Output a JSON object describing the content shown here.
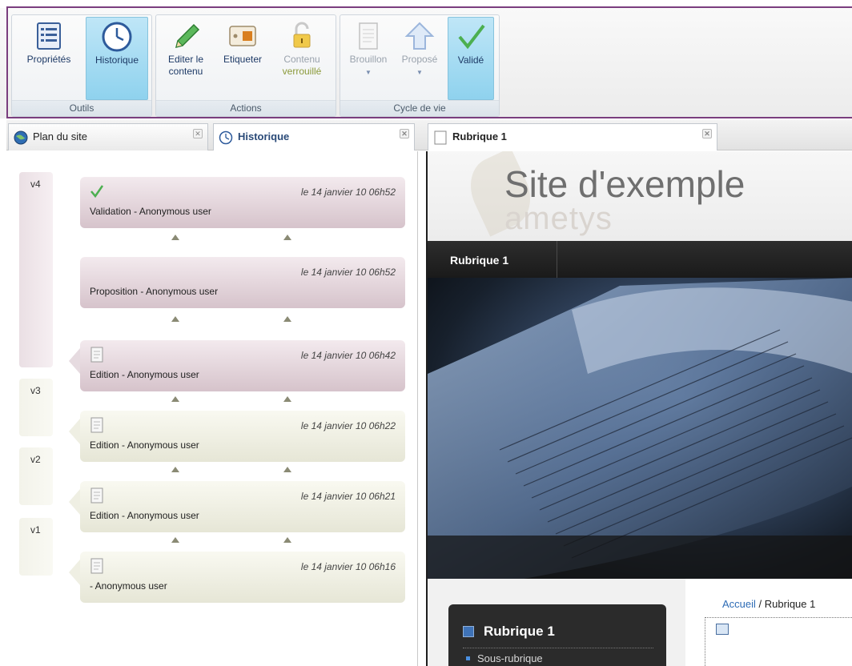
{
  "ribbon": {
    "groups": [
      {
        "label": "Outils"
      },
      {
        "label": "Actions"
      },
      {
        "label": "Cycle de vie"
      }
    ],
    "buttons": {
      "properties": "Propriétés",
      "history": "Historique",
      "edit_line1": "Editer le",
      "edit_line2": "contenu",
      "tag": "Etiqueter",
      "lock_line1": "Contenu",
      "lock_line2": "verrouillé",
      "draft": "Brouillon",
      "proposed": "Proposé",
      "validated": "Validé"
    }
  },
  "left_tabs": [
    {
      "label": "Plan du site",
      "icon": "globe-icon"
    },
    {
      "label": "Historique",
      "icon": "clock-icon",
      "active": true
    }
  ],
  "history": {
    "versions": [
      "v4",
      "v3",
      "v2",
      "v1"
    ],
    "entries": [
      {
        "date": "le 14 janvier 10 06h52",
        "description": "Validation - Anonymous user",
        "icon": "checkmark-icon"
      },
      {
        "date": "le 14 janvier 10 06h52",
        "description": "Proposition - Anonymous user",
        "icon": ""
      },
      {
        "date": "le 14 janvier 10 06h42",
        "description": "Edition - Anonymous user",
        "icon": "document-icon"
      },
      {
        "date": "le 14 janvier 10 06h22",
        "description": "Edition - Anonymous user",
        "icon": "document-icon"
      },
      {
        "date": "le 14 janvier 10 06h21",
        "description": "Edition - Anonymous user",
        "icon": "document-icon"
      },
      {
        "date": "le 14 janvier 10 06h16",
        "description": "- Anonymous user",
        "icon": "document-icon"
      }
    ]
  },
  "right_tab": {
    "label": "Rubrique 1",
    "icon": "page-icon"
  },
  "preview": {
    "site_title": "Site d'exemple",
    "site_subtitle": "ametys",
    "nav_item": "Rubrique 1",
    "sidebox_title": "Rubrique 1",
    "sidebox_item": "Sous-rubrique",
    "breadcrumb_home": "Accueil",
    "breadcrumb_sep": " / ",
    "breadcrumb_current": "Rubrique 1"
  },
  "colors": {
    "accent": "#7a3e7e",
    "active_button": "#8fd2ee",
    "link": "#2d6bb5"
  }
}
